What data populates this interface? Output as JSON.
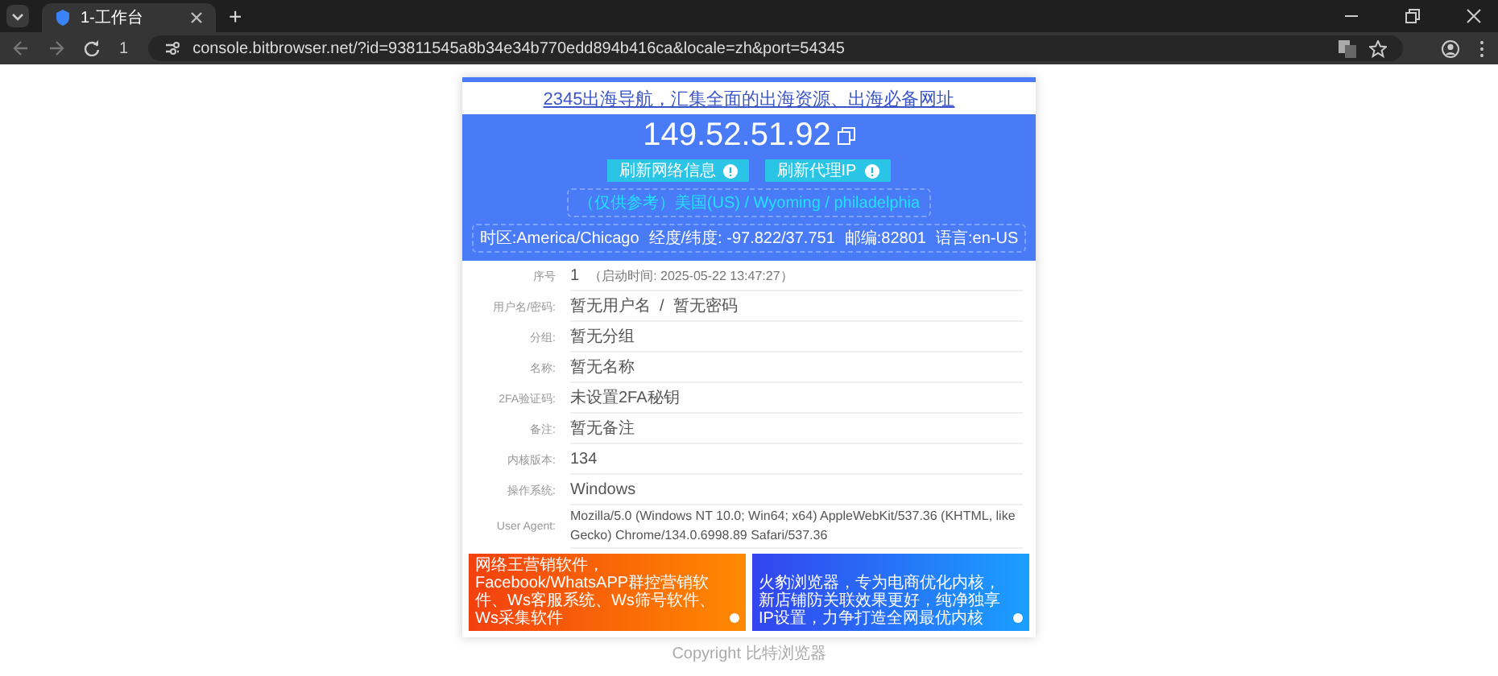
{
  "browser": {
    "tabs": [
      {
        "title": "1-工作台",
        "selected": true
      }
    ],
    "new_tab": "+",
    "profile_number": "1",
    "url": "console.bitbrowser.net/?id=93811545a8b34e34b770edd894b416ca&locale=zh&port=54345"
  },
  "banner_link": "2345出海导航，汇集全面的出海资源、出海必备网址",
  "ip": "149.52.51.92",
  "buttons": [
    "刷新网络信息",
    "刷新代理IP"
  ],
  "location": "（仅供参考）美国(US) / Wyoming / philadelphia",
  "facts": [
    "时区:America/Chicago",
    "经度/纬度: -97.822/37.751",
    "邮编:82801",
    "语言:en-US"
  ],
  "rows": [
    {
      "label": "序号",
      "value": "1",
      "note": "（启动时间: 2025-05-22 13:47:27）"
    },
    {
      "label": "用户名/密码:",
      "value": "暂无用户名  /  暂无密码"
    },
    {
      "label": "分组:",
      "value": "暂无分组"
    },
    {
      "label": "名称:",
      "value": "暂无名称"
    },
    {
      "label": "2FA验证码:",
      "value": "未设置2FA秘钥"
    },
    {
      "label": "备注:",
      "value": "暂无备注"
    },
    {
      "label": "内核版本:",
      "value": "134"
    },
    {
      "label": "操作系统:",
      "value": "Windows"
    },
    {
      "label": "User Agent:",
      "value": "Mozilla/5.0 (Windows NT 10.0; Win64; x64) AppleWebKit/537.36 (KHTML, like Gecko) Chrome/134.0.6998.89 Safari/537.36"
    }
  ],
  "ads": [
    {
      "text": "网络王营销软件，Facebook/WhatsAPP群控营销软件、Ws客服系统、Ws筛号软件、Ws采集软件",
      "kind": "orange"
    },
    {
      "text": "火豹浏览器，专为电商优化内核，新店铺防关联效果更好，纯净独享IP设置，力争打造全网最优内核",
      "kind": "blue"
    }
  ],
  "footer": "Copyright 比特浏览器"
}
